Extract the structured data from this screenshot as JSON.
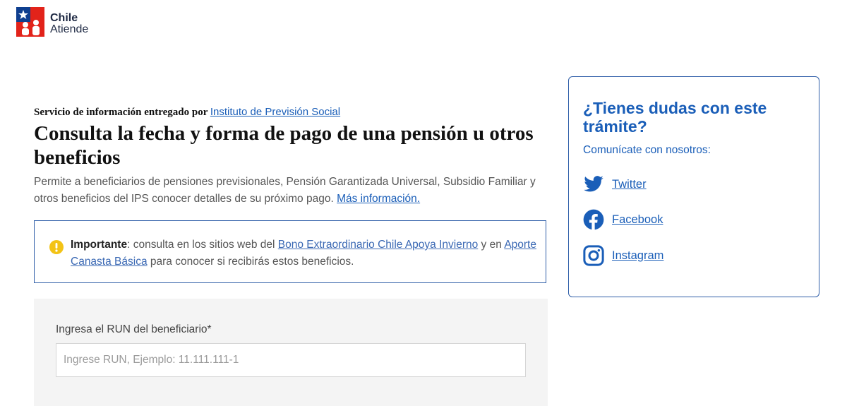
{
  "header": {
    "logo_line1": "Chile",
    "logo_line2": "Atiende"
  },
  "main": {
    "provider_prefix": "Servicio de información entregado por ",
    "provider_link": "Instituto de Previsión Social",
    "title": "Consulta la fecha y forma de pago de una pensión u otros beneficios",
    "description": "Permite a beneficiarios de pensiones previsionales, Pensión Garantizada Universal, Subsidio Familiar y otros beneficios del IPS conocer detalles de su próximo pago. ",
    "more_info_link": "Más información."
  },
  "notice": {
    "icon": "exclamation-circle-icon",
    "icon_color": "#f3c316",
    "label": "Importante",
    "text1": ": consulta en los sitios web del ",
    "link1": "Bono Extraordinario Chile Apoya Invierno",
    "text2": " y en ",
    "link2": "Aporte Canasta Básica",
    "text3": " para conocer si recibirás estos beneficios."
  },
  "form": {
    "label": "Ingresa el RUN del beneficiario*",
    "placeholder": "Ingrese RUN, Ejemplo: 11.111.111-1",
    "value": ""
  },
  "help": {
    "title": "¿Tienes dudas con este trámite?",
    "subtitle": "Comunícate con nosotros:",
    "links": [
      {
        "label": "Twitter",
        "icon": "twitter-icon"
      },
      {
        "label": "Facebook",
        "icon": "facebook-icon"
      },
      {
        "label": "Instagram",
        "icon": "instagram-icon"
      }
    ]
  },
  "colors": {
    "accent": "#1a5eb8",
    "border": "#2f5ea8",
    "brand_red": "#e2231a",
    "brand_blue": "#0f3f8f"
  }
}
